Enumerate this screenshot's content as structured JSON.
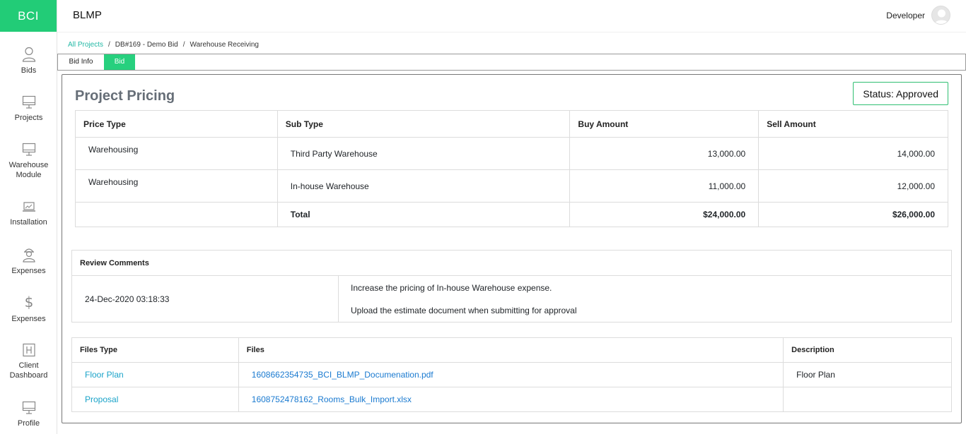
{
  "brand": "BCI",
  "app_title": "BLMP",
  "user": {
    "name": "Developer",
    "avatar_icon": "user-avatar-icon"
  },
  "sidebar": {
    "items": [
      {
        "label": "Bids",
        "icon": "user-icon"
      },
      {
        "label": "Projects",
        "icon": "monitor-icon"
      },
      {
        "label": "Warehouse Module",
        "icon": "monitor-icon"
      },
      {
        "label": "Installation",
        "icon": "laptop-chart-icon"
      },
      {
        "label": "Expenses",
        "icon": "worker-icon"
      },
      {
        "label": "Expenses",
        "icon": "dollar-icon"
      },
      {
        "label": "Client Dashboard",
        "icon": "building-icon"
      },
      {
        "label": "Profile",
        "icon": "monitor-icon"
      }
    ]
  },
  "breadcrumb": [
    "All Projects",
    "DB#169 - Demo Bid",
    "Warehouse Receiving"
  ],
  "tabs": [
    {
      "label": "Bid Info",
      "active": false
    },
    {
      "label": "Bid",
      "active": true
    }
  ],
  "pricing": {
    "title": "Project Pricing",
    "status": "Status: Approved",
    "headers": [
      "Price Type",
      "Sub Type",
      "Buy Amount",
      "Sell Amount"
    ],
    "rows": [
      {
        "price_type": "Warehousing",
        "sub_type": "Third Party Warehouse",
        "buy": "13,000.00",
        "sell": "14,000.00"
      },
      {
        "price_type": "Warehousing",
        "sub_type": "In-house Warehouse",
        "buy": "11,000.00",
        "sell": "12,000.00"
      }
    ],
    "total": {
      "label": "Total",
      "buy": "$24,000.00",
      "sell": "$26,000.00"
    }
  },
  "review": {
    "header": "Review Comments",
    "date": "24-Dec-2020 03:18:33",
    "comments": [
      "Increase the pricing of In-house Warehouse expense.",
      "Upload the estimate document when submitting for approval"
    ]
  },
  "files": {
    "headers": [
      "Files Type",
      "Files",
      "Description"
    ],
    "rows": [
      {
        "type": "Floor Plan",
        "file": "1608662354735_BCI_BLMP_Documenation.pdf",
        "description": "Floor Plan"
      },
      {
        "type": "Proposal",
        "file": "1608752478162_Rooms_Bulk_Import.xlsx",
        "description": ""
      }
    ]
  },
  "colors": {
    "brand": "#22cc77",
    "active_tab": "#27d07e",
    "link": "#1aa3c9",
    "status_border": "#2fbf71"
  }
}
